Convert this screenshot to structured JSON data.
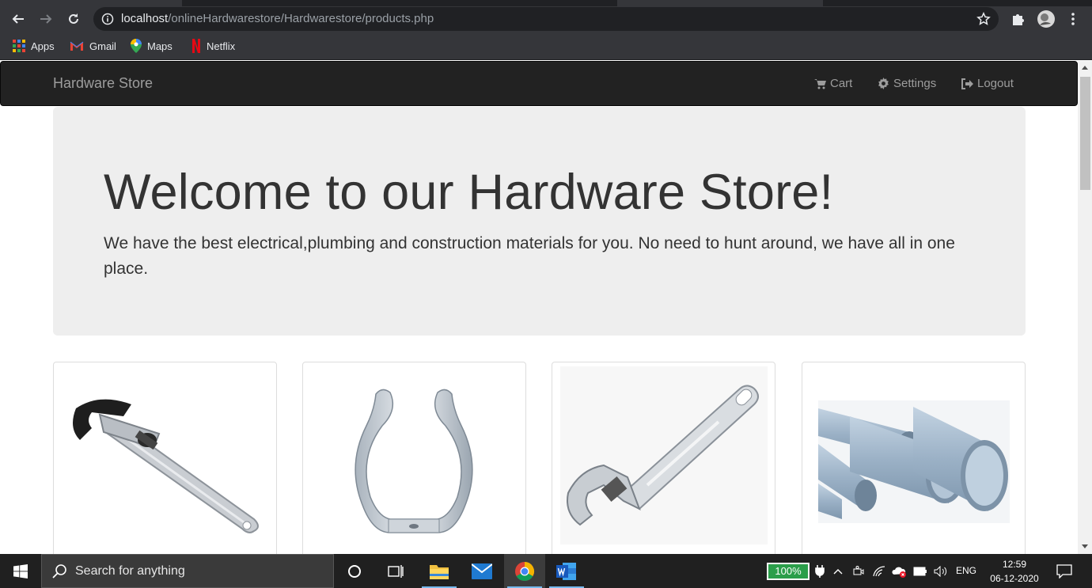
{
  "browser": {
    "url_host": "localhost",
    "url_path": "/onlineHardwarestore/Hardwarestore/products.php",
    "bookmarks": [
      {
        "label": "Apps",
        "icon": "apps-grid-icon"
      },
      {
        "label": "Gmail",
        "icon": "gmail-icon"
      },
      {
        "label": "Maps",
        "icon": "maps-pin-icon"
      },
      {
        "label": "Netflix",
        "icon": "netflix-icon"
      }
    ]
  },
  "site": {
    "brand": "Hardware Store",
    "nav": {
      "cart": "Cart",
      "settings": "Settings",
      "logout": "Logout"
    },
    "hero": {
      "title": "Welcome to our Hardware Store!",
      "text": "We have the best electrical,plumbing and construction materials for you. No need to hunt around, we have all in one place."
    },
    "products": [
      {
        "image": "pipe-wrench"
      },
      {
        "image": "tube-clip"
      },
      {
        "image": "adjustable-wrench"
      },
      {
        "image": "pvc-pipes"
      }
    ]
  },
  "taskbar": {
    "search_placeholder": "Search for anything",
    "battery": "100%",
    "battery_level": 1.0,
    "language": "ENG",
    "time": "12:59",
    "date": "06-12-2020"
  },
  "colors": {
    "navbar_bg": "#222222",
    "jumbotron_bg": "#eeeeee",
    "text": "#333333",
    "chrome_dark": "#35363a",
    "taskbar_bg": "#202020"
  }
}
